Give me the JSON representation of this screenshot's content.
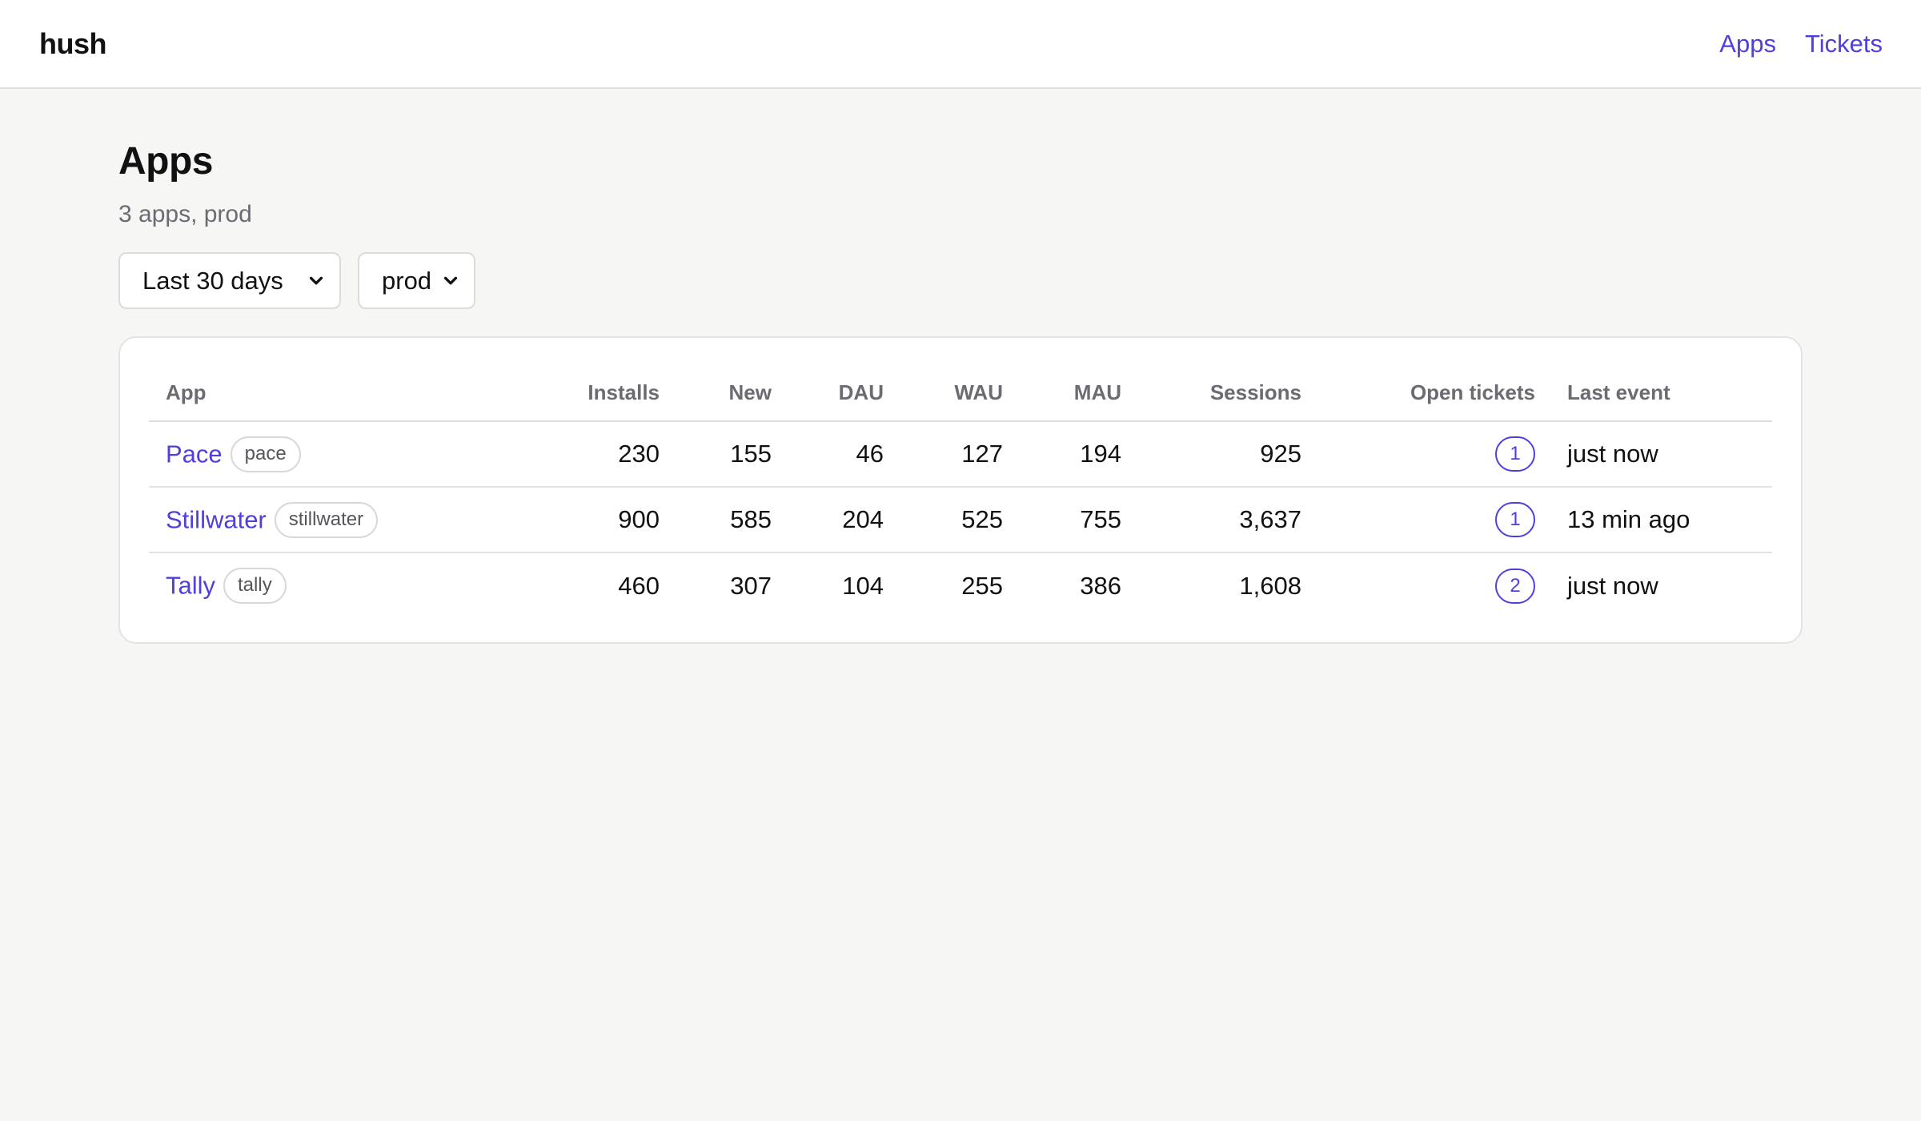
{
  "header": {
    "brand": "hush",
    "nav": [
      {
        "label": "Apps"
      },
      {
        "label": "Tickets"
      }
    ]
  },
  "page": {
    "title": "Apps",
    "subtitle": "3 apps, prod"
  },
  "filters": {
    "range": {
      "value": "Last 30 days",
      "icon": "chevron-down-icon"
    },
    "env": {
      "value": "prod",
      "icon": "chevron-down-icon"
    }
  },
  "table": {
    "columns": [
      "App",
      "Installs",
      "New",
      "DAU",
      "WAU",
      "MAU",
      "Sessions",
      "Open tickets",
      "Last event"
    ],
    "rows": [
      {
        "name": "Pace",
        "slug": "pace",
        "installs": "230",
        "new": "155",
        "dau": "46",
        "wau": "127",
        "mau": "194",
        "sessions": "925",
        "open_tickets": "1",
        "last_event": "just now"
      },
      {
        "name": "Stillwater",
        "slug": "stillwater",
        "installs": "900",
        "new": "585",
        "dau": "204",
        "wau": "525",
        "mau": "755",
        "sessions": "3,637",
        "open_tickets": "1",
        "last_event": "13 min ago"
      },
      {
        "name": "Tally",
        "slug": "tally",
        "installs": "460",
        "new": "307",
        "dau": "104",
        "wau": "255",
        "mau": "386",
        "sessions": "1,608",
        "open_tickets": "2",
        "last_event": "just now"
      }
    ]
  },
  "colors": {
    "accent": "#4f3fdc",
    "background": "#f6f6f5",
    "muted_text": "#6b6b72"
  }
}
